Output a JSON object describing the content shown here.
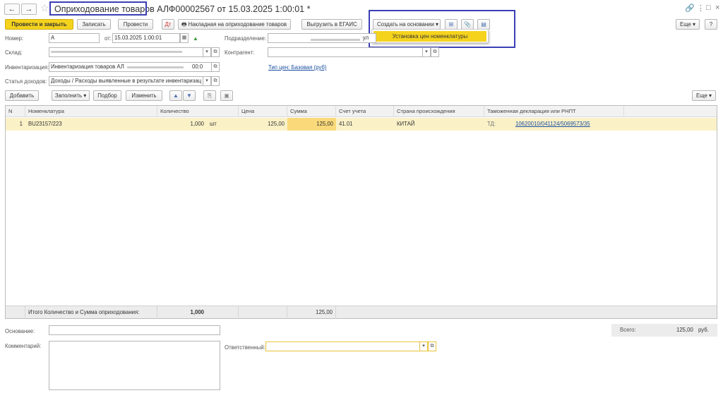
{
  "title": {
    "doc_type": "Оприходование товаров",
    "doc_number_date": "АЛФ00002567 от 15.03.2025 1:00:01 *"
  },
  "toolbar": {
    "post_close": "Провести и закрыть",
    "save": "Записать",
    "post": "Провести",
    "invoice": "Накладная на оприходование товаров",
    "egais": "Выгрузить в ЕГАИС",
    "create_based": "Создать на основании",
    "more": "Еще"
  },
  "dropdown": {
    "item": "Установка цен номенклатуры"
  },
  "form": {
    "number_label": "Номер:",
    "number_value": "А",
    "from_label": "от:",
    "date_value": "15.03.2025  1:00:01",
    "division_label": "Подразделение:",
    "division_value": "ул",
    "warehouse_label": "Склад:",
    "counterparty_label": "Контрагент:",
    "inventory_label": "Инвентаризация:",
    "inventory_value": "Инвентаризация товаров АЛ",
    "inventory_tail": "00:0",
    "price_type_link": "Тип цен: Базовая (руб)",
    "income_label": "Статья доходов:",
    "income_value": "Доходы / Расходы выявленные в результате инвентаризац"
  },
  "table_toolbar": {
    "add": "Добавить",
    "fill": "Заполнить",
    "select": "Подбор",
    "change": "Изменить",
    "more": "Еще"
  },
  "table": {
    "headers": {
      "n": "N",
      "item": "Номенклатура",
      "qty": "Количество",
      "price": "Цена",
      "sum": "Сумма",
      "account": "Счет учета",
      "country": "Страна происхождения",
      "customs": "Таможенная декларация или РНПТ"
    },
    "rows": [
      {
        "n": "1",
        "item": "BU23157/223",
        "qty": "1,000",
        "unit": "шт",
        "price": "125,00",
        "sum": "125,00",
        "account": "41.01",
        "country": "КИТАЙ",
        "customs_prefix": "ТД:",
        "customs": "10620010/041124/5069573/35"
      }
    ],
    "footer": {
      "label": "Итого Количество и Сумма оприходования:",
      "qty": "1,000",
      "sum": "125,00"
    }
  },
  "bottom": {
    "basis_label": "Основание:",
    "comment_label": "Комментарий:",
    "responsible_label": "Ответственный:",
    "total_label": "Всего:",
    "total_value": "125,00",
    "currency": "руб."
  },
  "colors": {
    "accent_yellow": "#f5d31d",
    "row_highlight": "#fbf1c7",
    "annotation_blue": "#3b3fb5",
    "link_blue": "#1a4fa0"
  }
}
